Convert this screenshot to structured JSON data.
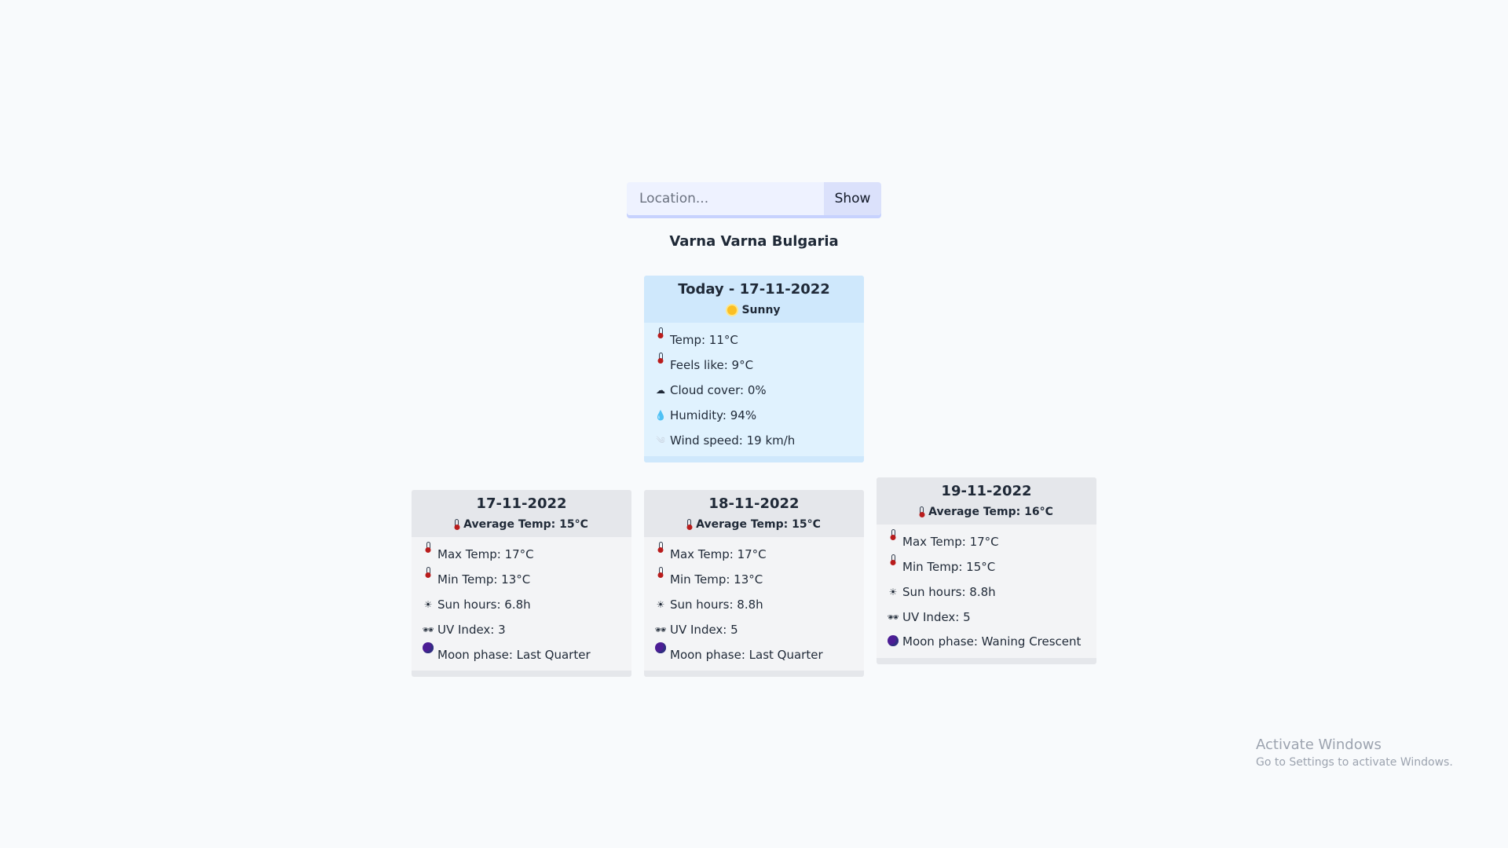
{
  "search": {
    "placeholder": "Location...",
    "value": "",
    "button_label": "Show"
  },
  "location": "Varna Varna Bulgaria",
  "today": {
    "title": "Today - 17-11-2022",
    "condition": "Sunny",
    "condition_icon": "sun-icon",
    "rows": [
      {
        "icon": "thermometer-icon",
        "text": "Temp: 11°C"
      },
      {
        "icon": "thermometer-icon",
        "text": "Feels like: 9°C"
      },
      {
        "icon": "cloud-icon",
        "text": "Cloud cover: 0%"
      },
      {
        "icon": "droplet-icon",
        "text": "Humidity: 94%"
      },
      {
        "icon": "wind-icon",
        "text": "Wind speed: 19 km/h"
      }
    ]
  },
  "forecast": [
    {
      "date": "17-11-2022",
      "avg": "Average Temp: 15°C",
      "rows": [
        {
          "icon": "thermometer-icon",
          "text": "Max Temp: 17°C"
        },
        {
          "icon": "thermometer-icon",
          "text": "Min Temp: 13°C"
        },
        {
          "icon": "sun-icon",
          "text": "Sun hours: 6.8h"
        },
        {
          "icon": "sunglasses-icon",
          "text": "UV Index: 3"
        },
        {
          "icon": "moon-icon",
          "text": "Moon phase: Last Quarter"
        }
      ]
    },
    {
      "date": "18-11-2022",
      "avg": "Average Temp: 15°C",
      "rows": [
        {
          "icon": "thermometer-icon",
          "text": "Max Temp: 17°C"
        },
        {
          "icon": "thermometer-icon",
          "text": "Min Temp: 13°C"
        },
        {
          "icon": "sun-icon",
          "text": "Sun hours: 8.8h"
        },
        {
          "icon": "sunglasses-icon",
          "text": "UV Index: 5"
        },
        {
          "icon": "moon-icon",
          "text": "Moon phase: Last Quarter"
        }
      ]
    },
    {
      "date": "19-11-2022",
      "avg": "Average Temp: 16°C",
      "rows": [
        {
          "icon": "thermometer-icon",
          "text": "Max Temp: 17°C"
        },
        {
          "icon": "thermometer-icon",
          "text": "Min Temp: 15°C"
        },
        {
          "icon": "sun-icon",
          "text": "Sun hours: 8.8h"
        },
        {
          "icon": "sunglasses-icon",
          "text": "UV Index: 5"
        },
        {
          "icon": "moon-icon",
          "text": "Moon phase: Waning Crescent"
        }
      ]
    }
  ],
  "watermark": {
    "title": "Activate Windows",
    "subtitle": "Go to Settings to activate Windows."
  },
  "colors": {
    "background": "#f8fafc",
    "today_card": "#e0f2fe",
    "today_header": "#cfe8fc",
    "forecast_card": "#f3f4f6",
    "forecast_header": "#e5e7eb",
    "search_input": "#eef2ff",
    "search_button": "#dbe1fb"
  }
}
